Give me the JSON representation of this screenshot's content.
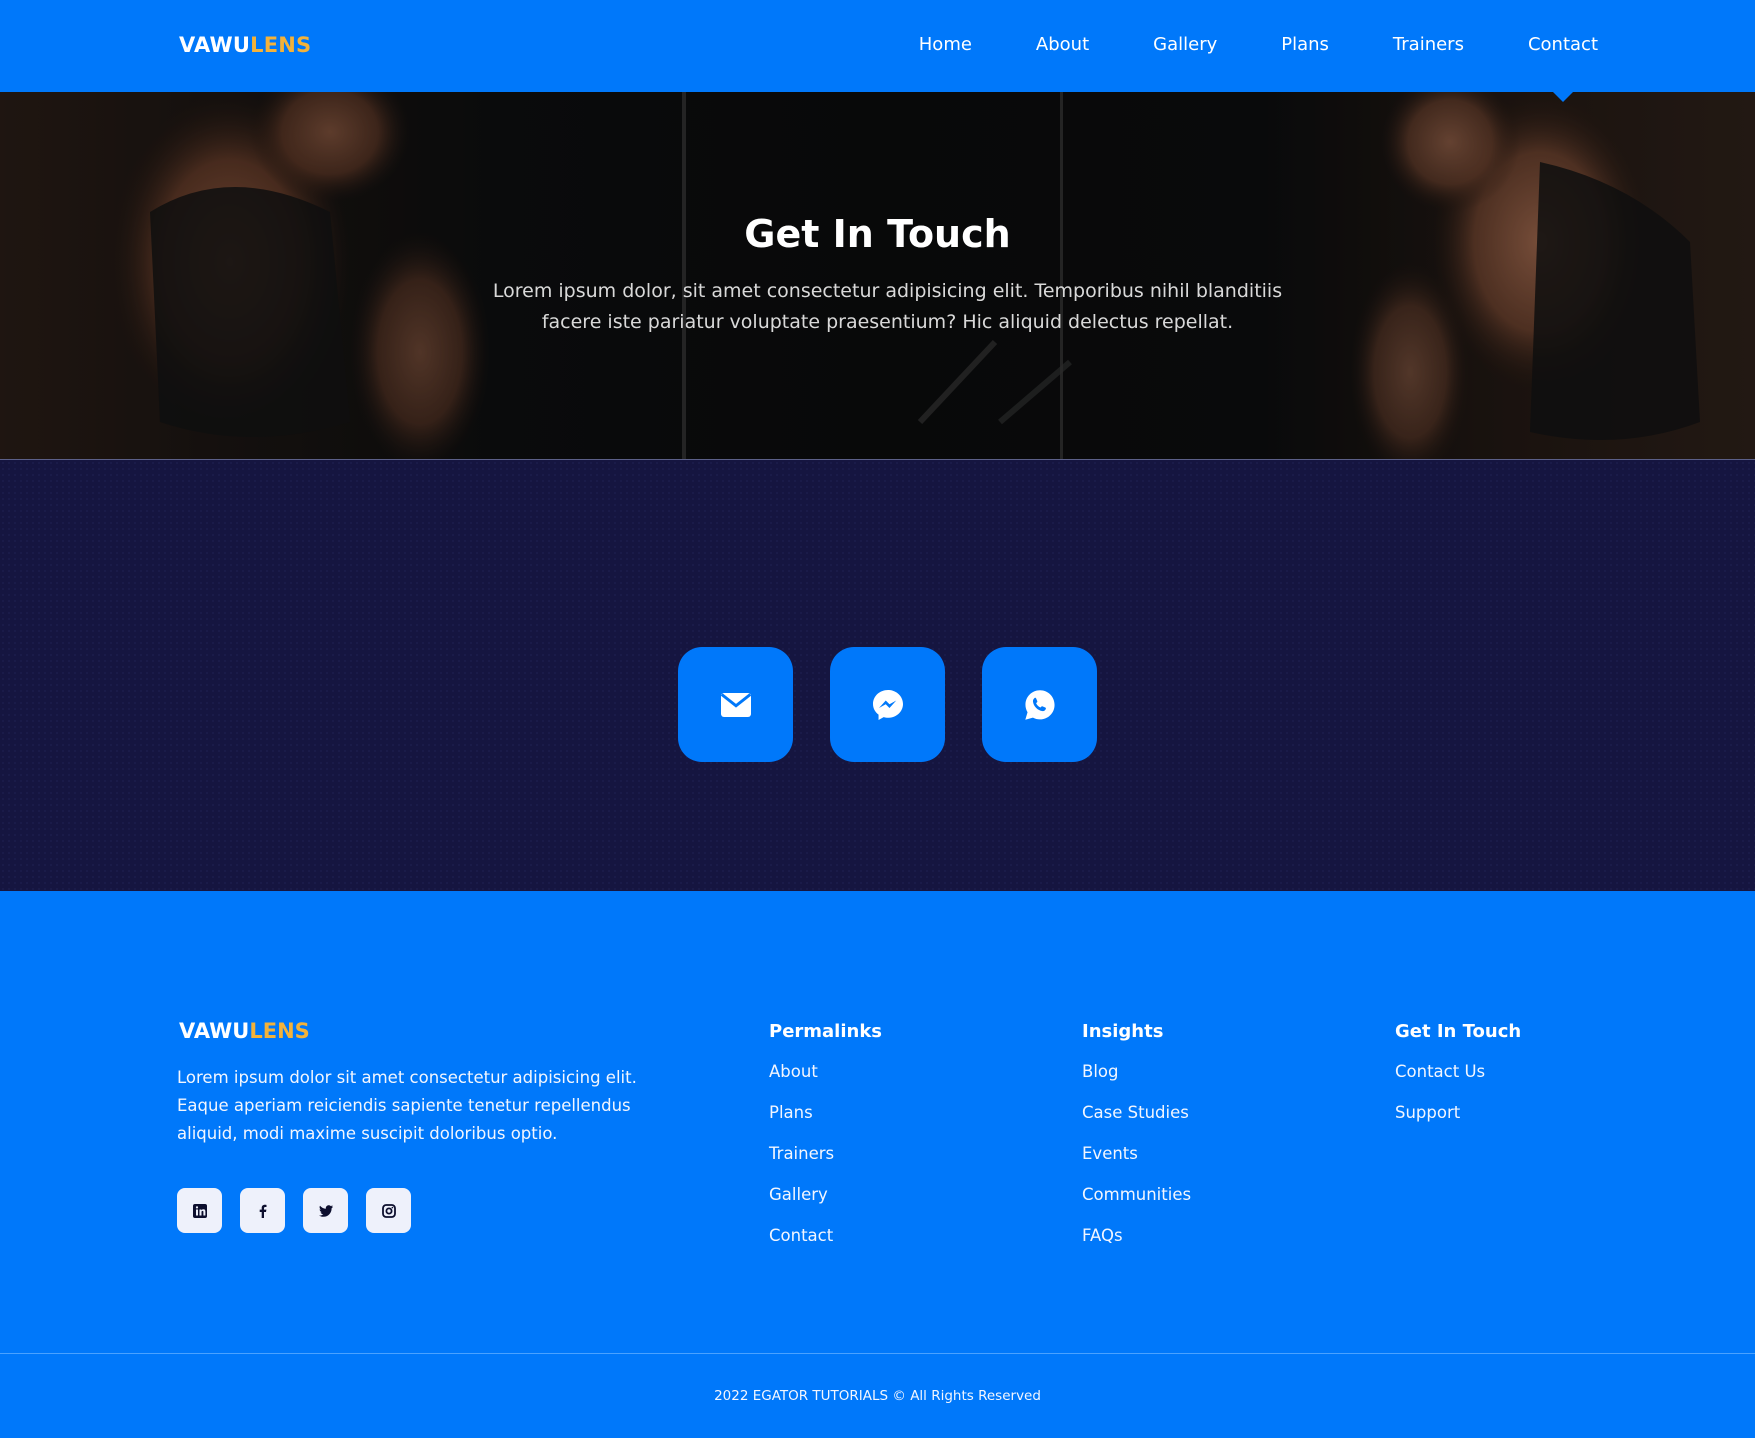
{
  "brand": {
    "part1": "VAWU",
    "part2": "LENS"
  },
  "nav": {
    "items": [
      "Home",
      "About",
      "Gallery",
      "Plans",
      "Trainers",
      "Contact"
    ],
    "active": "Contact"
  },
  "hero": {
    "title": "Get In Touch",
    "text": "Lorem ipsum dolor, sit amet consectetur adipisicing elit. Temporibus nihil blanditiis facere iste pariatur voluptate praesentium? Hic aliquid delectus repellat."
  },
  "contact_icons": [
    "mail-icon",
    "messenger-icon",
    "whatsapp-icon"
  ],
  "footer": {
    "about": "Lorem ipsum dolor sit amet consectetur adipisicing elit. Eaque aperiam reiciendis sapiente tenetur repellendus aliquid, modi maxime suscipit doloribus optio.",
    "socials": [
      "linkedin-icon",
      "facebook-icon",
      "twitter-icon",
      "instagram-icon"
    ],
    "permalinks": {
      "title": "Permalinks",
      "links": [
        "About",
        "Plans",
        "Trainers",
        "Gallery",
        "Contact"
      ]
    },
    "insights": {
      "title": "Insights",
      "links": [
        "Blog",
        "Case Studies",
        "Events",
        "Communities",
        "FAQs"
      ]
    },
    "get_in_touch": {
      "title": "Get In Touch",
      "links": [
        "Contact Us",
        "Support"
      ]
    },
    "copyright": "2022 EGATOR TUTORIALS © All Rights Reserved"
  },
  "colors": {
    "primary": "#0078fa",
    "accent": "#f3b23a",
    "dark_section": "#151540"
  }
}
